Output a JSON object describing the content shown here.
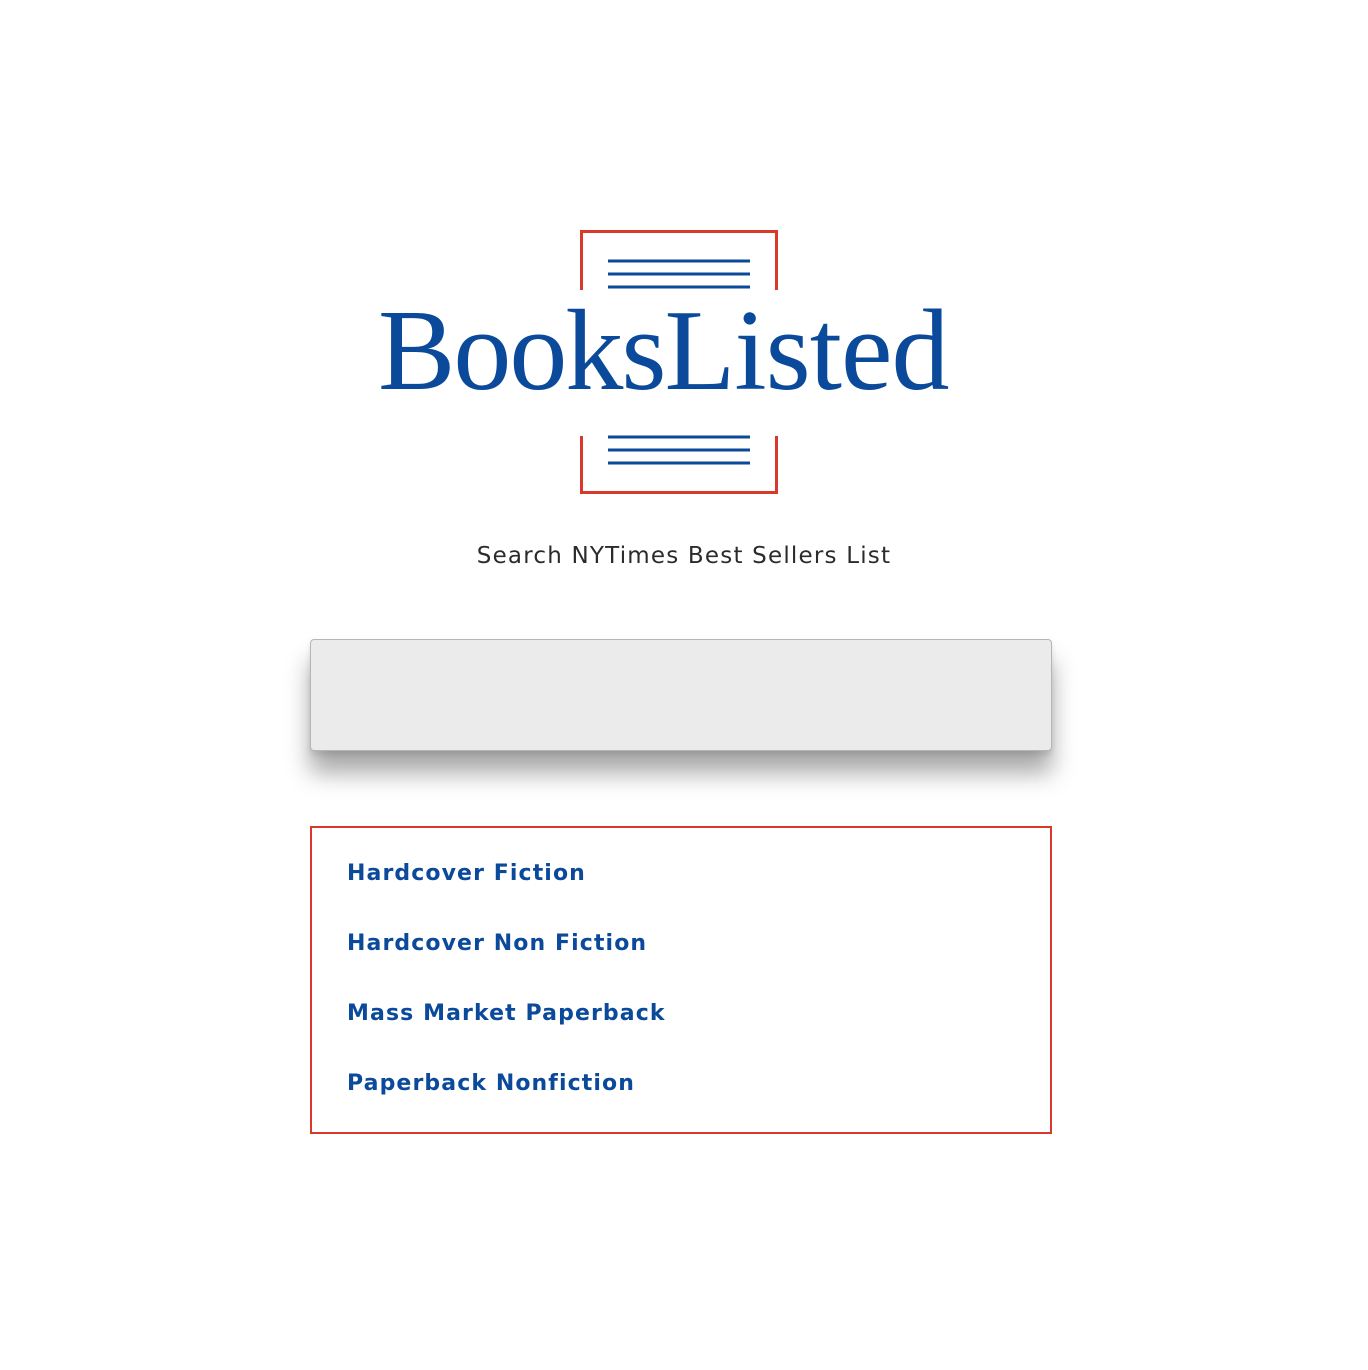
{
  "logo": {
    "word1": "Books",
    "word2": "Listed"
  },
  "tagline": "Search NYTimes Best Sellers List",
  "search": {
    "placeholder": "",
    "value": ""
  },
  "categories": [
    {
      "label": "Hardcover Fiction"
    },
    {
      "label": "Hardcover Non Fiction"
    },
    {
      "label": "Mass Market Paperback"
    },
    {
      "label": "Paperback Nonfiction"
    }
  ],
  "colors": {
    "brand_blue": "#0b4a9a",
    "accent_red": "#d9392b",
    "text_dark": "#2b2b2b",
    "input_bg": "#ebebeb"
  }
}
